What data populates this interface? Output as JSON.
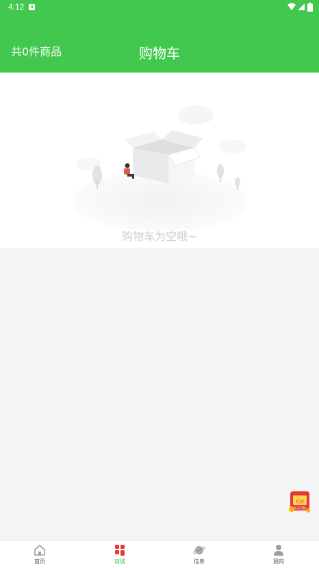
{
  "status_bar": {
    "time": "4:12",
    "badge": "A"
  },
  "header": {
    "count_label": "共0件商品",
    "title": "购物车"
  },
  "empty_state": {
    "message": "购物车为空哦~"
  },
  "floating_badge": {
    "text_top": "打扮",
    "text_bottom": "天天打扮"
  },
  "tabs": [
    {
      "label": "首页",
      "icon": "home-icon",
      "active": false
    },
    {
      "label": "商城",
      "icon": "shop-icon",
      "active": true
    },
    {
      "label": "信息",
      "icon": "planet-icon",
      "active": false
    },
    {
      "label": "我的",
      "icon": "user-icon",
      "active": false
    }
  ],
  "colors": {
    "brand": "#42c84f",
    "active_tab": "#e53935"
  }
}
